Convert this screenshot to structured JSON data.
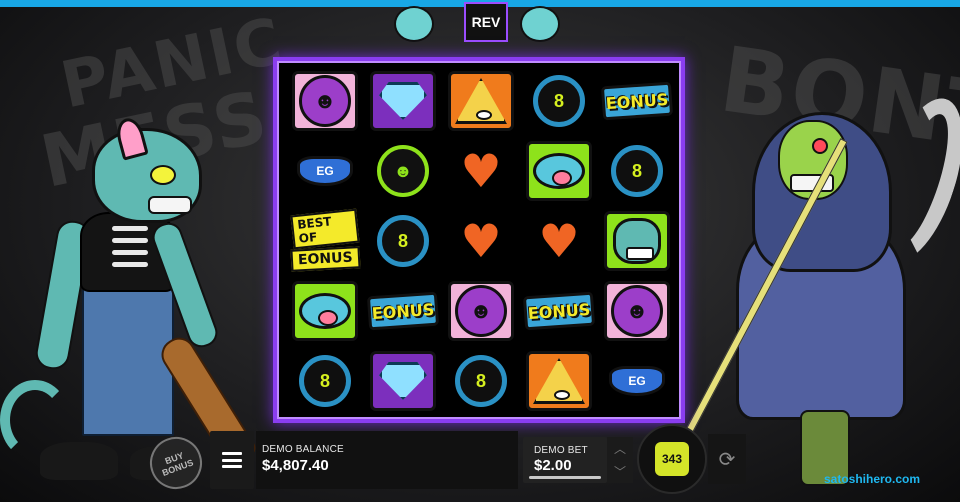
{
  "grid": [
    [
      "smiley-purple",
      "diamond",
      "pyramid",
      "coin",
      "bonus"
    ],
    [
      "wings",
      "smiley-green",
      "heart",
      "mouth",
      "coin"
    ],
    [
      "bestof",
      "coin",
      "heart",
      "heart",
      "catface"
    ],
    [
      "mouth",
      "bonus",
      "smiley-purple",
      "bonus",
      "smiley-purple"
    ],
    [
      "coin",
      "diamond",
      "coin",
      "pyramid",
      "wings"
    ]
  ],
  "symbols": {
    "bonus_text": "EONUS",
    "bestof_line1": "BEST OF",
    "bestof_line2": "EONUS",
    "coin_glyph": "8",
    "smiley_glyph": "☻",
    "heart_glyph": "♥",
    "wings_glyph": "EG"
  },
  "title": {
    "fragment": "REV"
  },
  "buy_bonus": {
    "label": "BUY BONUS"
  },
  "balance": {
    "label": "DEMO BALANCE",
    "value": "$4,807.40"
  },
  "bet": {
    "label": "DEMO BET",
    "value": "$2.00"
  },
  "spin": {
    "count": "343"
  },
  "icons": {
    "menu": "hamburger-menu-icon",
    "bet_up": "chevron-up-icon",
    "bet_down": "chevron-down-icon",
    "autoplay": "autoplay-icon"
  },
  "watermark": "satoshihero.com",
  "colors": {
    "top_bar": "#18a7e6",
    "frame": "#8a3df0",
    "spin_button": "#d4e429",
    "watermark": "#1fb8f0"
  }
}
